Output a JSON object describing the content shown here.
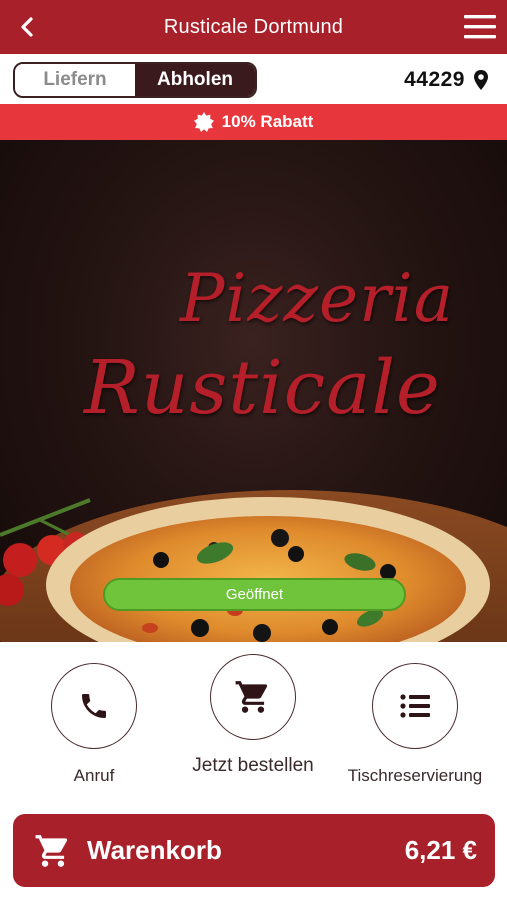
{
  "header": {
    "title": "Rusticale Dortmund",
    "back_icon": "chevron-left-icon",
    "menu_icon": "hamburger-menu-icon",
    "bg_color": "#a8202a"
  },
  "mode": {
    "options": [
      "Liefern",
      "Abholen"
    ],
    "selected": "Abholen",
    "zip": "44229",
    "zip_icon": "map-pin-icon"
  },
  "promo": {
    "icon": "badge-icon",
    "text": "10% Rabatt",
    "bg_color": "#e7363c"
  },
  "hero": {
    "brand_line1": "Pizzeria",
    "brand_line2": "Rusticale",
    "status": "Geöffnet",
    "status_color": "#6fc43b"
  },
  "actions": [
    {
      "label": "Anruf",
      "icon": "phone-icon"
    },
    {
      "label": "Jetzt bestellen",
      "icon": "shopping-cart-icon"
    },
    {
      "label": "Tischreservierung",
      "icon": "list-icon"
    }
  ],
  "cart": {
    "icon": "shopping-cart-icon",
    "label": "Warenkorb",
    "total": "6,21 €"
  }
}
